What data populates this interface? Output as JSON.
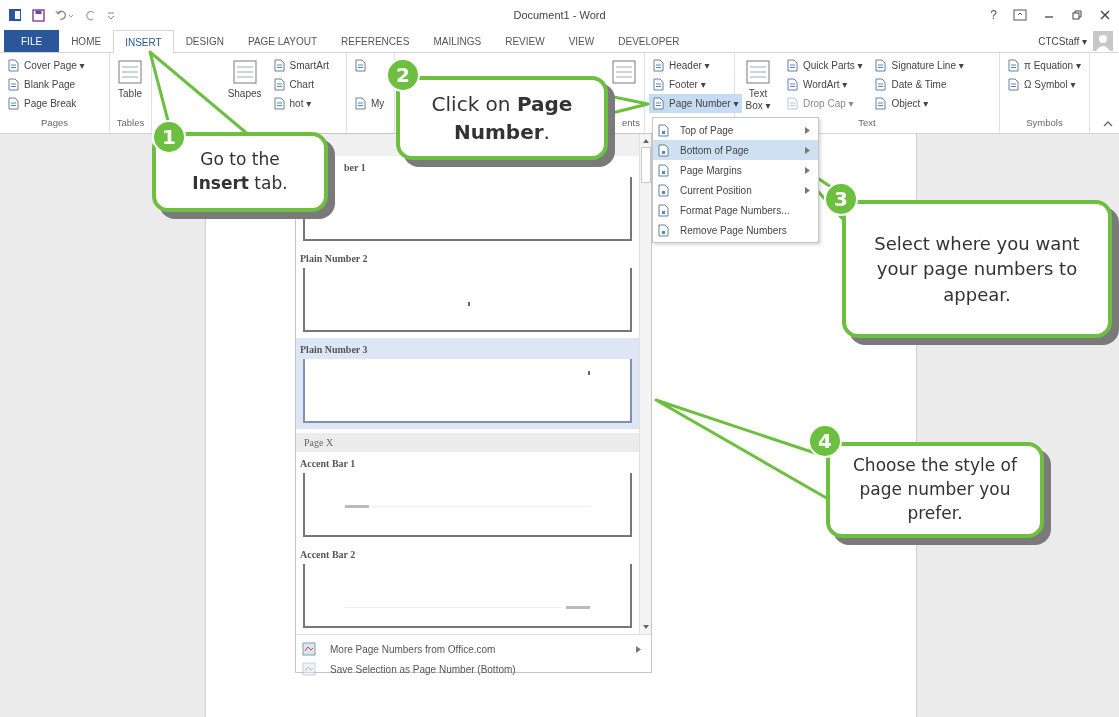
{
  "window": {
    "title": "Document1 - Word",
    "help": "?"
  },
  "tabs": [
    {
      "label": "FILE",
      "kind": "file",
      "selected": false
    },
    {
      "label": "HOME",
      "kind": "tab",
      "selected": false
    },
    {
      "label": "INSERT",
      "kind": "tab",
      "selected": true
    },
    {
      "label": "DESIGN",
      "kind": "tab",
      "selected": false
    },
    {
      "label": "PAGE LAYOUT",
      "kind": "tab",
      "selected": false
    },
    {
      "label": "REFERENCES",
      "kind": "tab",
      "selected": false
    },
    {
      "label": "MAILINGS",
      "kind": "tab",
      "selected": false
    },
    {
      "label": "REVIEW",
      "kind": "tab",
      "selected": false
    },
    {
      "label": "VIEW",
      "kind": "tab",
      "selected": false
    },
    {
      "label": "DEVELOPER",
      "kind": "tab",
      "selected": false
    }
  ],
  "user": {
    "name": "CTCStaff ▾"
  },
  "ribbon": {
    "groups": [
      {
        "label": "Pages",
        "columns": [
          [
            {
              "kind": "small",
              "label": "Cover Page ▾",
              "disabled": false,
              "open": false
            },
            {
              "kind": "small",
              "label": "Blank Page",
              "disabled": false,
              "open": false
            },
            {
              "kind": "small",
              "label": "Page Break",
              "disabled": false,
              "open": false
            }
          ]
        ]
      },
      {
        "label": "Tables",
        "columns": [
          [
            {
              "kind": "large",
              "label": "Table",
              "disabled": false,
              "open": false
            }
          ]
        ]
      },
      {
        "columns": [
          [
            {
              "kind": "large",
              "label": "Shapes",
              "disabled": false,
              "open": false
            }
          ],
          [
            {
              "kind": "small",
              "label": "SmartArt",
              "disabled": false,
              "open": false
            },
            {
              "kind": "small",
              "label": "Chart",
              "disabled": false,
              "open": false
            },
            {
              "kind": "small",
              "label": "hot ▾",
              "disabled": false,
              "open": false
            }
          ]
        ]
      },
      {
        "columns": [
          [
            {
              "kind": "small",
              "disabled": false,
              "open": false
            },
            {
              "kind": "small",
              "label": "My",
              "disabled": false,
              "open": false
            }
          ]
        ]
      },
      {
        "label": "ents",
        "columns": [
          [
            {
              "kind": "large",
              "disabled": false,
              "open": false
            }
          ]
        ]
      },
      {
        "columns": [
          [
            {
              "kind": "small",
              "label": "Header ▾",
              "disabled": false,
              "open": false
            },
            {
              "kind": "small",
              "label": "Footer ▾",
              "disabled": false,
              "open": false
            },
            {
              "kind": "small",
              "label": "Page Number ▾",
              "disabled": false,
              "open": true
            }
          ]
        ]
      },
      {
        "label": "Text",
        "columns": [
          [
            {
              "kind": "large",
              "label": "Text Box ▾",
              "disabled": false,
              "open": false
            }
          ],
          [
            {
              "kind": "small",
              "label": "Quick Parts ▾",
              "disabled": false,
              "open": false
            },
            {
              "kind": "small",
              "label": "WordArt ▾",
              "disabled": false,
              "open": false
            },
            {
              "kind": "small",
              "label": "Drop Cap ▾",
              "disabled": true,
              "open": false
            }
          ],
          [
            {
              "kind": "small",
              "label": "Signature Line ▾",
              "disabled": false,
              "open": false
            },
            {
              "kind": "small",
              "label": "Date & Time",
              "disabled": false,
              "open": false
            },
            {
              "kind": "small",
              "label": "Object ▾",
              "disabled": false,
              "open": false
            }
          ]
        ]
      },
      {
        "label": "Symbols",
        "columns": [
          [
            {
              "kind": "small",
              "label": "π Equation ▾",
              "disabled": false,
              "open": false
            },
            {
              "kind": "small",
              "label": "Ω Symbol ▾",
              "disabled": false,
              "open": false
            }
          ]
        ]
      }
    ]
  },
  "gallery": {
    "items": [
      {
        "kind": "blank",
        "label": "ber 1",
        "selected": false
      },
      {
        "kind": "centered",
        "label": "Plain Number 2",
        "selected": false
      },
      {
        "kind": "rightside",
        "label": "Plain Number 3",
        "selected": true
      },
      {
        "kind": "header",
        "label": "Page X"
      },
      {
        "kind": "accentleft",
        "label": "Accent Bar 1",
        "selected": false
      },
      {
        "kind": "accentright",
        "label": "Accent Bar 2",
        "selected": false
      }
    ],
    "commands": [
      {
        "label": "More Page Numbers from Office.com",
        "disabled": false,
        "submenu": true
      },
      {
        "label": "Save Selection as Page Number (Bottom)",
        "disabled": true,
        "submenu": false
      }
    ]
  },
  "submenu": [
    {
      "label": "Top of Page",
      "selected": false,
      "submenu": true
    },
    {
      "label": "Bottom of Page",
      "selected": true,
      "submenu": true
    },
    {
      "label": "Page Margins",
      "selected": false,
      "submenu": true
    },
    {
      "label": "Current Position",
      "selected": false,
      "submenu": true
    },
    {
      "label": "Format Page Numbers...",
      "selected": false,
      "submenu": false
    },
    {
      "label": "Remove Page Numbers",
      "selected": false,
      "submenu": false
    }
  ],
  "callouts": [
    {
      "step": "1",
      "text": "Go to the **Insert** tab."
    },
    {
      "step": "2",
      "text": "Click on **Page Number**."
    },
    {
      "step": "3",
      "text": "Select where you want your page numbers to appear."
    },
    {
      "step": "4",
      "text": "Choose the style of page number you prefer."
    }
  ]
}
